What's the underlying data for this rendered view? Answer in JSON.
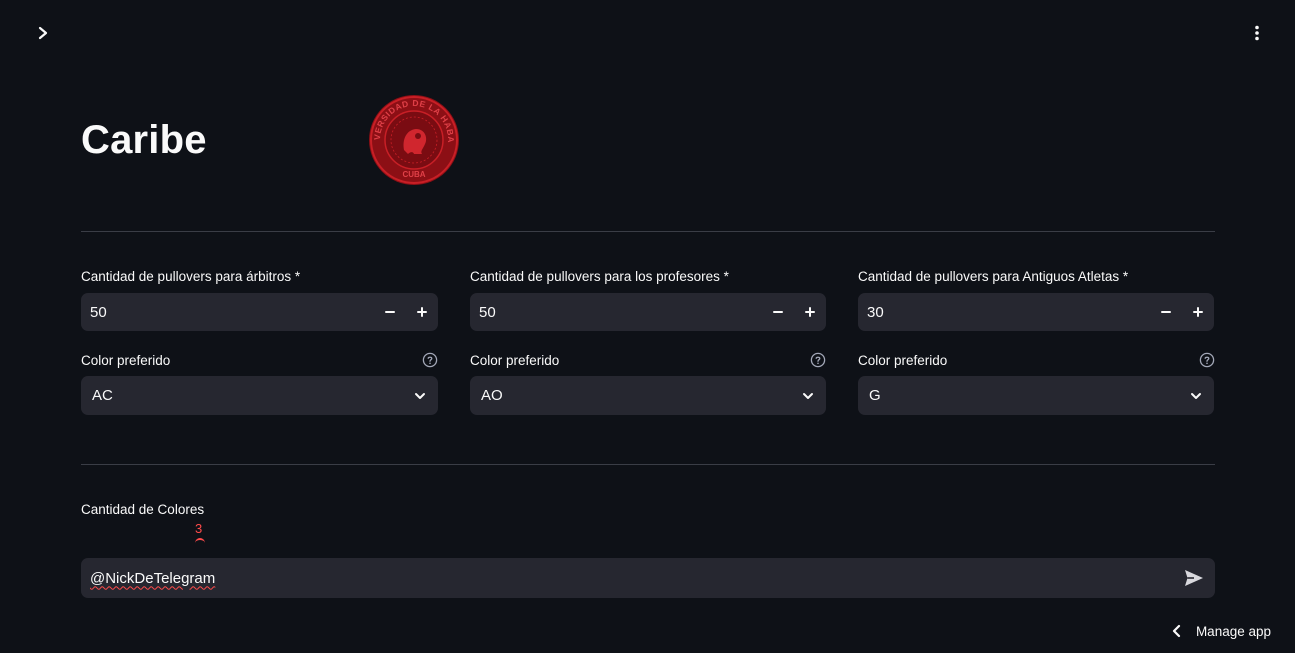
{
  "header": {
    "sidebar_toggle_icon": "chevron-right-icon",
    "menu_icon": "kebab-menu-icon"
  },
  "page": {
    "title": "Caribe",
    "logo": {
      "ring_text": "UNIVERSIDAD DE LA HABANA",
      "bottom_text": "CUBA",
      "color": "#b3141b"
    }
  },
  "columns": [
    {
      "qty_label": "Cantidad de pullovers para árbitros *",
      "qty_value": "50",
      "color_label": "Color preferido",
      "color_value": "AC"
    },
    {
      "qty_label": "Cantidad de pullovers para los profesores *",
      "qty_value": "50",
      "color_label": "Color preferido",
      "color_value": "AO"
    },
    {
      "qty_label": "Cantidad de pullovers para Antiguos Atletas *",
      "qty_value": "30",
      "color_label": "Color preferido",
      "color_value": "G"
    }
  ],
  "slider": {
    "label": "Cantidad de Colores",
    "value": "3",
    "accent": "#ff4b4b"
  },
  "chat": {
    "value": "@NickDeTelegram",
    "send_icon": "send-icon"
  },
  "footer": {
    "manage_label": "Manage app"
  },
  "theme": {
    "background": "#0e1117",
    "widget": "#262730",
    "accent": "#ff4b4b"
  }
}
